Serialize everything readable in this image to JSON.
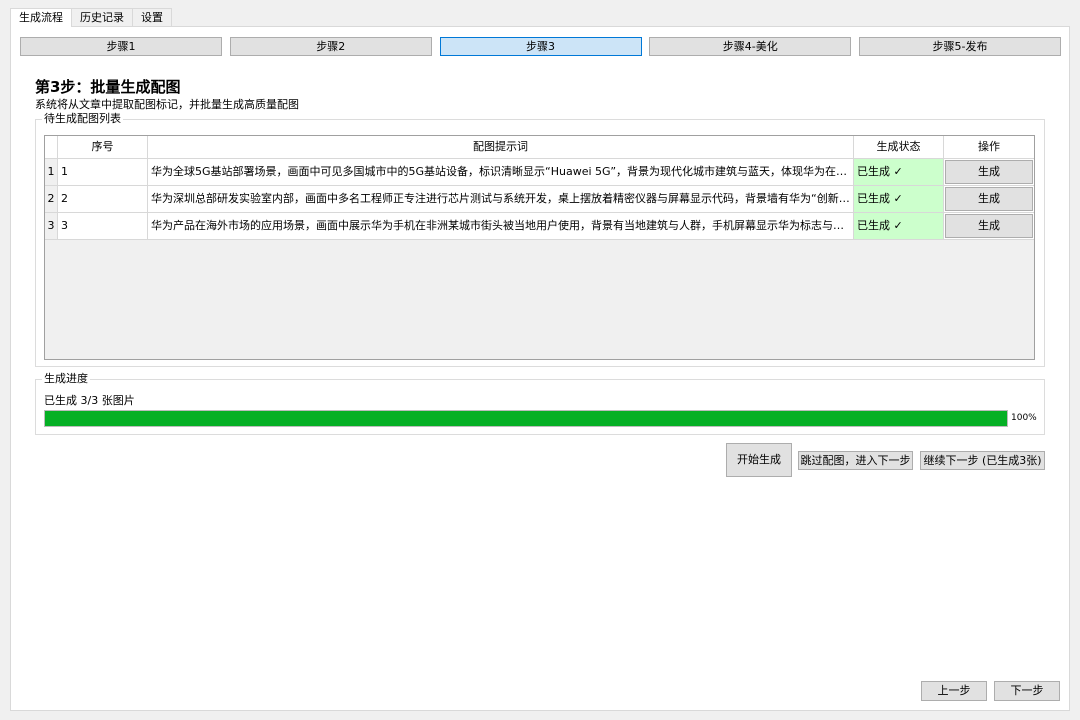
{
  "tabs": [
    "生成流程",
    "历史记录",
    "设置"
  ],
  "steps": [
    "步骤1",
    "步骤2",
    "步骤3",
    "步骤4-美化",
    "步骤5-发布"
  ],
  "header": {
    "title": "第3步：批量生成配图",
    "description": "系统将从文章中提取配图标记，并批量生成高质量配图"
  },
  "list_group": {
    "label": "待生成配图列表",
    "columns": [
      "序号",
      "配图提示词",
      "生成状态",
      "操作"
    ],
    "rows": [
      {
        "row_header": "1",
        "num": "1",
        "prompt": "华为全球5G基站部署场景，画面中可见多国城市中的5G基站设备，标识清晰显示“Huawei 5G”，背景为现代化城市建筑与蓝天，体现华为在全球...",
        "status": "已生成 ✓",
        "action": "生成"
      },
      {
        "row_header": "2",
        "num": "2",
        "prompt": "华为深圳总部研发实验室内部，画面中多名工程师正专注进行芯片测试与系统开发，桌上摆放着精密仪器与屏幕显示代码，背景墙有华为“创新驱...",
        "status": "已生成 ✓",
        "action": "生成"
      },
      {
        "row_header": "3",
        "num": "3",
        "prompt": "华为产品在海外市场的应用场景，画面中展示华为手机在非洲某城市街头被当地用户使用，背景有当地建筑与人群，手机屏幕显示华为标志与当地...",
        "status": "已生成 ✓",
        "action": "生成"
      }
    ]
  },
  "progress_group": {
    "label": "生成进度",
    "text": "已生成 3/3 张图片",
    "percent_label": "100%",
    "fraction": 1.0
  },
  "actions": {
    "start": "开始生成",
    "skip": "跳过配图，进入下一步",
    "continue": "继续下一步 (已生成3张)"
  },
  "nav": {
    "prev": "上一步",
    "next": "下一步"
  },
  "colors": {
    "progress_fill": "#06b025",
    "status_bg": "#ccffcc",
    "active_step_bg": "#cce4f7",
    "active_step_border": "#0078d7"
  }
}
